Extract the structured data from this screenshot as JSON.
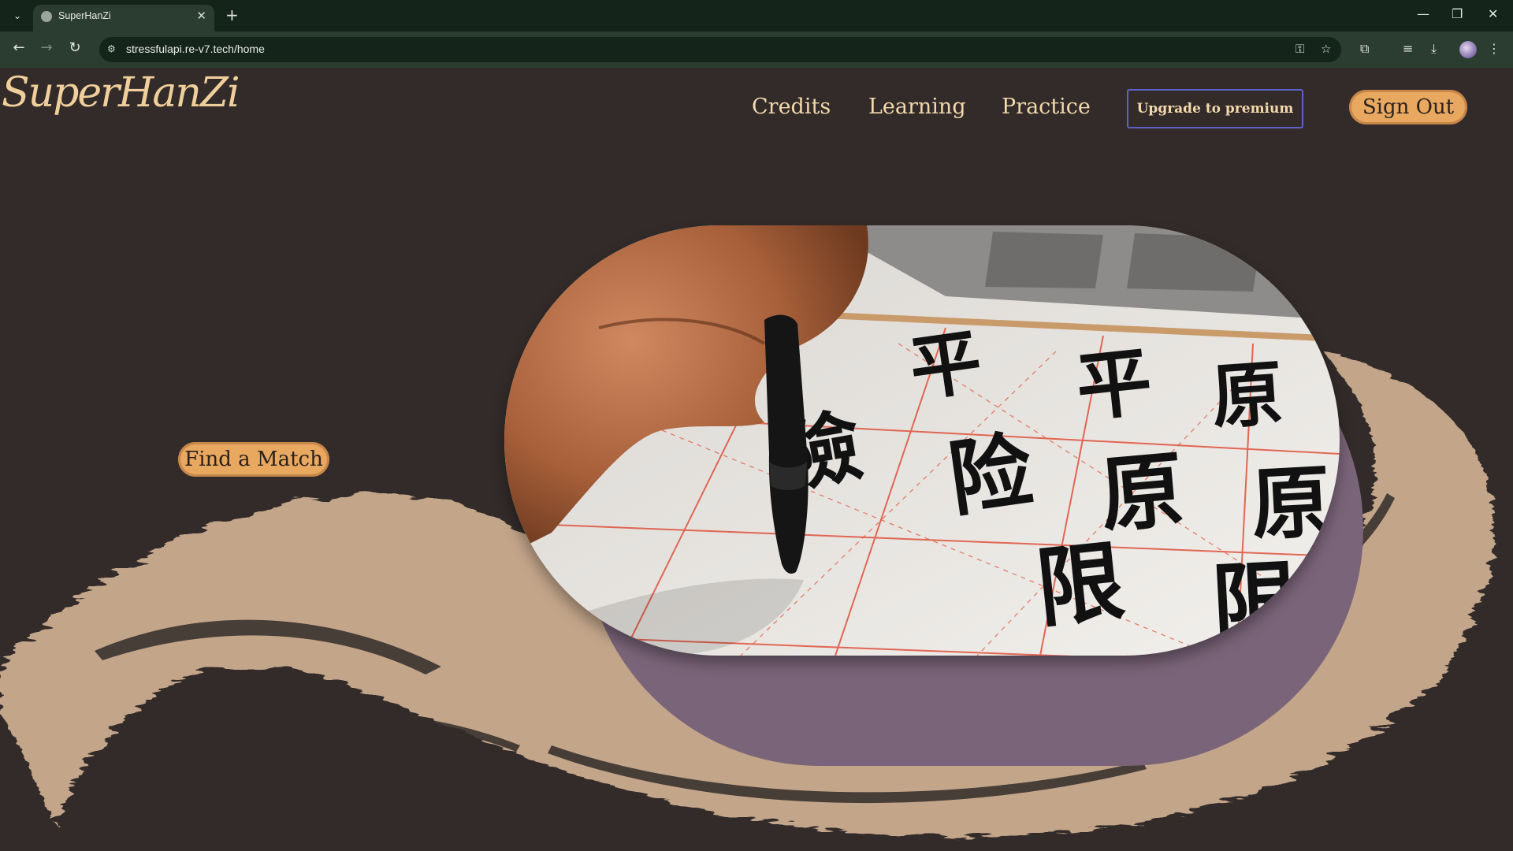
{
  "browser": {
    "tab_title": "SuperHanZi",
    "url": "stressfulapi.re-v7.tech/home",
    "new_tab_symbol": "+",
    "icons": [
      "tab-search-icon",
      "globe-icon",
      "close-icon",
      "back-icon",
      "forward-icon",
      "reload-icon",
      "site-info-icon",
      "password-key-icon",
      "bookmark-star-icon",
      "extensions-icon",
      "media-queue-icon",
      "download-icon",
      "profile-avatar",
      "menu-dots-icon",
      "minimize-icon",
      "restore-icon",
      "window-close-icon"
    ]
  },
  "site": {
    "logo": "SuperHanZi",
    "nav": {
      "credits": "Credits",
      "learning": "Learning",
      "practice": "Practice",
      "upgrade": "Upgrade to premium",
      "sign_out": "Sign Out"
    },
    "hero": {
      "cta": "Find a Match",
      "image_alt": "calligraphy-brush-photo",
      "characters": [
        "限",
        "原",
        "原",
        "限",
        "平",
        "平",
        "险",
        "險",
        "原"
      ]
    }
  },
  "colors": {
    "page_bg": "#322b29",
    "accent_gold": "#f3d9ad",
    "button_orange": "#e8a860",
    "brush_tan": "#c3a58a",
    "premium_border": "#5b63c9",
    "hero_shadow": "#7a6479"
  }
}
